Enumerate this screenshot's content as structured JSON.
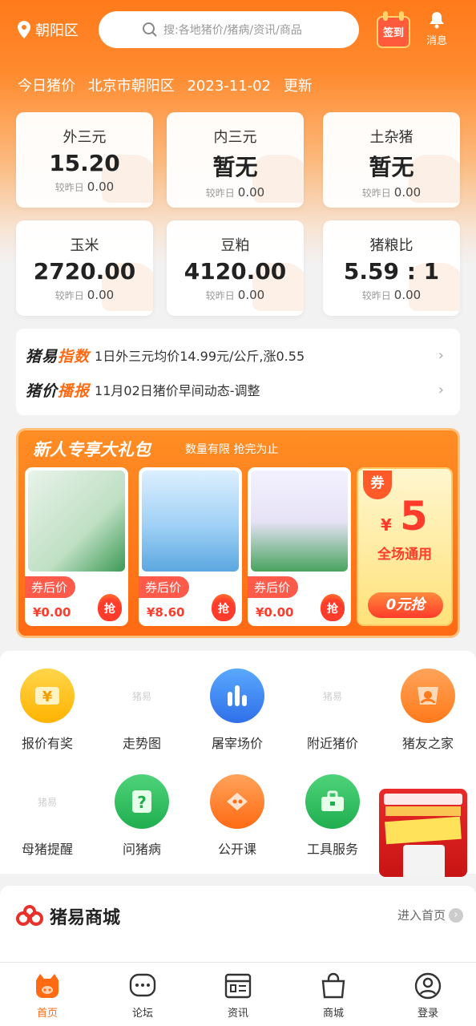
{
  "topbar": {
    "location": "朝阳区",
    "search_placeholder": "搜:各地猪价/猪病/资讯/商品",
    "signin_label": "签到",
    "message_label": "消息"
  },
  "today": {
    "label": "今日猪价",
    "region": "北京市朝阳区",
    "date": "2023-11-02",
    "suffix": "更新"
  },
  "prices": [
    {
      "name": "外三元",
      "value": "15.20",
      "change_label": "较昨日",
      "change": "0.00"
    },
    {
      "name": "内三元",
      "value": "暂无",
      "change_label": "较昨日",
      "change": "0.00"
    },
    {
      "name": "土杂猪",
      "value": "暂无",
      "change_label": "较昨日",
      "change": "0.00"
    },
    {
      "name": "玉米",
      "value": "2720.00",
      "change_label": "较昨日",
      "change": "0.00"
    },
    {
      "name": "豆粕",
      "value": "4120.00",
      "change_label": "较昨日",
      "change": "0.00"
    },
    {
      "name": "猪粮比",
      "value": "5.59 : 1",
      "change_label": "较昨日",
      "change": "0.00"
    }
  ],
  "news": [
    {
      "tag_a": "猪易",
      "tag_b": "指数",
      "text": "1日外三元均价14.99元/公斤,涨0.55"
    },
    {
      "tag_a": "猪价",
      "tag_b": "播报",
      "text": "11月02日猪价早间动态-调整"
    }
  ],
  "promo": {
    "title": "新人专享大礼包",
    "subtitle": "数量有限 抢完为止",
    "products": [
      {
        "after_label": "券后价",
        "price": "¥0.00",
        "grab": "抢"
      },
      {
        "after_label": "券后价",
        "price": "¥8.60",
        "grab": "抢"
      },
      {
        "after_label": "券后价",
        "price": "¥0.00",
        "grab": "抢"
      }
    ],
    "coupon": {
      "tag": "券",
      "currency": "¥",
      "amount": "5",
      "scope": "全场通用",
      "button": "0元抢"
    }
  },
  "grid": [
    {
      "label": "报价有奖",
      "icon": "yen-tag-icon"
    },
    {
      "label": "走势图",
      "icon": "placeholder-logo-icon",
      "placeholder": "猪易"
    },
    {
      "label": "屠宰场价",
      "icon": "bar-chart-icon"
    },
    {
      "label": "附近猪价",
      "icon": "placeholder-logo-icon",
      "placeholder": "猪易"
    },
    {
      "label": "猪友之家",
      "icon": "pig-home-icon"
    },
    {
      "label": "母猪提醒",
      "icon": "placeholder-logo-icon",
      "placeholder": "猪易"
    },
    {
      "label": "问猪病",
      "icon": "question-doc-icon"
    },
    {
      "label": "公开课",
      "icon": "play-course-icon"
    },
    {
      "label": "工具服务",
      "icon": "toolbox-icon"
    }
  ],
  "mall": {
    "title": "猪易商城",
    "enter": "进入首页"
  },
  "tabs": [
    {
      "label": "首页",
      "icon": "home-pig-icon",
      "active": true
    },
    {
      "label": "论坛",
      "icon": "chat-icon",
      "active": false
    },
    {
      "label": "资讯",
      "icon": "news-icon",
      "active": false
    },
    {
      "label": "商城",
      "icon": "bag-icon",
      "active": false
    },
    {
      "label": "登录",
      "icon": "user-icon",
      "active": false
    }
  ],
  "colors": {
    "accent": "#ff6a13",
    "price_red": "#ff3b2b"
  }
}
